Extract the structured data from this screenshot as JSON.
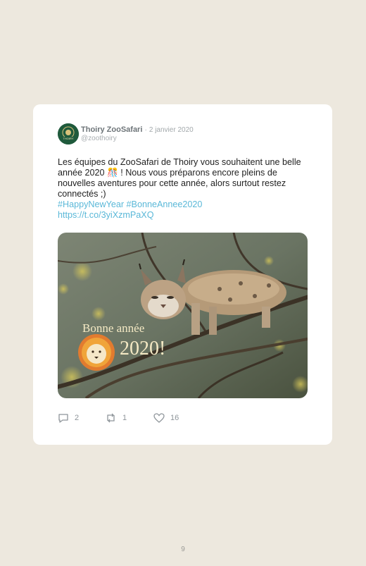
{
  "tweet": {
    "author_name": "Thoiry ZooSafari",
    "date_separator": "·",
    "date": "2 janvier 2020",
    "handle": "@zoothoiry",
    "text": "Les équipes du ZooSafari de Thoiry vous souhaitent une belle année 2020 🎊 ! Nous vous préparons encore pleins de nouvelles aventures pour cette année, alors surtout restez connectés ;)",
    "hashtags": "#HappyNewYear #BonneAnnee2020",
    "link": "https://t.co/3yiXzmPaXQ",
    "image": {
      "subject": "lynx-in-tree-photo",
      "greeting_line1": "Bonne année",
      "greeting_line2": "2020!"
    },
    "avatar_text": "THOIRY"
  },
  "actions": {
    "replies": "2",
    "retweets": "1",
    "likes": "16"
  },
  "page_number": "9",
  "colors": {
    "background": "#ede8de",
    "card": "#ffffff",
    "link": "#5ab8d8",
    "avatar": "#1f5a3c"
  }
}
